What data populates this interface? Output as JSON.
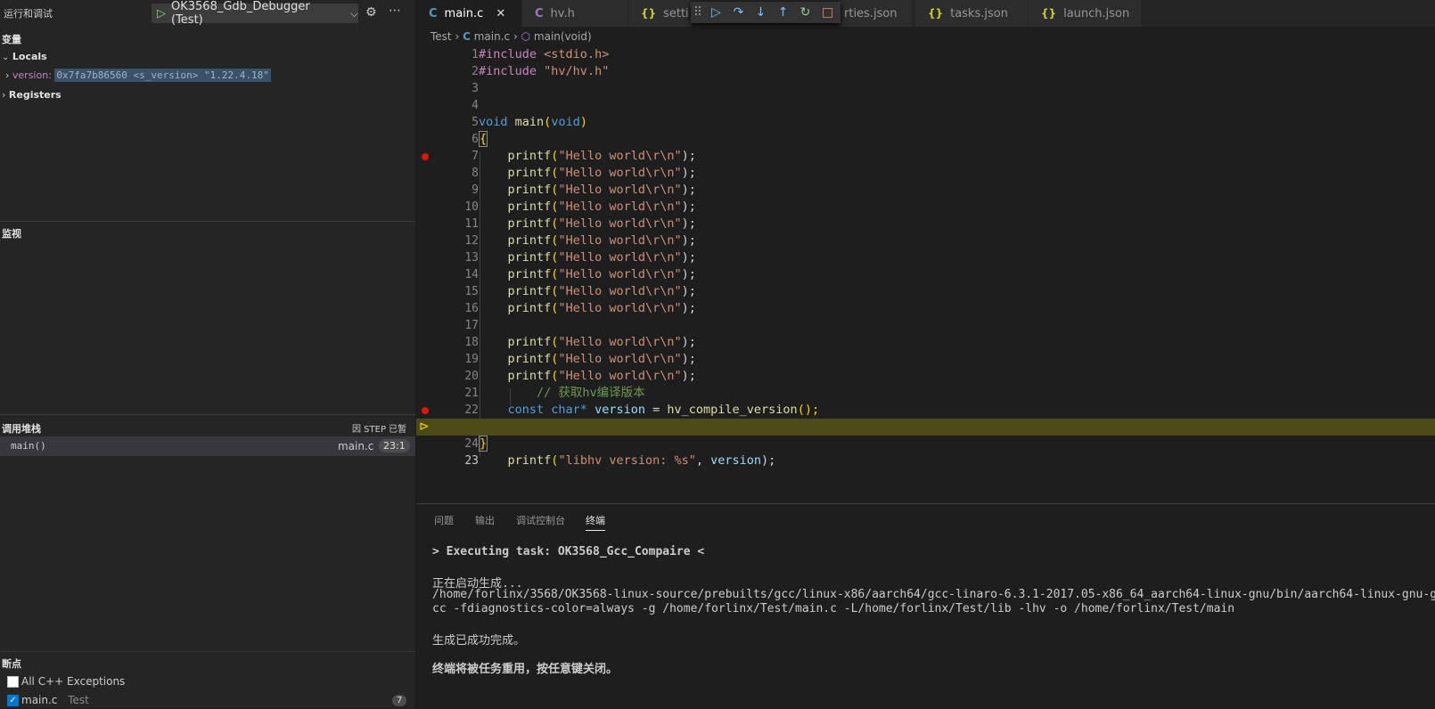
{
  "sidebar": {
    "title": "运行和调试",
    "config_name": "OK3568_Gdb_Debugger (Test)",
    "variables_title": "变量",
    "locals_label": "Locals",
    "var_name": "version:",
    "var_value": "0x7fa7b86560 <s_version> \"1.22.4.18\"",
    "registers_label": "Registers",
    "watch_title": "监视",
    "callstack_title": "调用堆栈",
    "callstack_status": "因 STEP 已暂停",
    "callstack_frame": "main()",
    "callstack_file": "main.c",
    "callstack_pos": "23:1",
    "breakpoints_title": "断点",
    "bp_exceptions": "All C++ Exceptions",
    "bp_file": "main.c",
    "bp_folder": "Test",
    "bp_count": "7"
  },
  "tabs": [
    {
      "icon": "C",
      "label": "main.c"
    },
    {
      "icon": "C",
      "label": "hv.h"
    },
    {
      "icon": "{}",
      "label": "setti"
    },
    {
      "icon": "{}",
      "label": "rties.json"
    },
    {
      "icon": "{}",
      "label": "tasks.json"
    },
    {
      "icon": "{}",
      "label": "launch.json"
    }
  ],
  "breadcrumb": {
    "folder": "Test",
    "file": "main.c",
    "symbol": "main(void)"
  },
  "code_lines": [
    "1",
    "2",
    "3",
    "4",
    "5",
    "6",
    "7",
    "8",
    "9",
    "10",
    "11",
    "12",
    "13",
    "14",
    "15",
    "16",
    "17",
    "18",
    "19",
    "20",
    "21",
    "22",
    "23",
    "24"
  ],
  "code": {
    "include1_kw": "#include",
    "include1_file": "<stdio.h>",
    "include2_kw": "#include",
    "include2_file": "\"hv/hv.h\"",
    "void_kw": "void",
    "main_fn": "main",
    "open_paren": "(",
    "param_void": "void",
    "close_paren": ")",
    "open_brace": "{",
    "printf": "printf",
    "hello_str": "\"Hello world\\r\\n\"",
    "printf_tail": ");",
    "comment": "// 获取hv编译版本",
    "const_kw": "const",
    "char_kw": "char*",
    "version_var": "version",
    "assign": " = ",
    "compile_fn": "hv_compile_version",
    "call_end": "();",
    "libhv_str": "\"libhv version: %s\"",
    "comma": ", ",
    "close_brace": "}"
  },
  "panel": {
    "tabs": [
      "问题",
      "输出",
      "调试控制台",
      "终端"
    ],
    "task_line": "> Executing task: OK3568_Gcc_Compaire <",
    "starting": "正在启动生成...",
    "cmd_line1": "/home/forlinx/3568/OK3568-linux-source/prebuilts/gcc/linux-x86/aarch64/gcc-linaro-6.3.1-2017.05-x86_64_aarch64-linux-gnu/bin/aarch64-linux-gnu-g",
    "cmd_line2": "cc -fdiagnostics-color=always -g /home/forlinx/Test/main.c -L/home/forlinx/Test/lib -lhv -o /home/forlinx/Test/main",
    "success": "生成已成功完成。",
    "reuse": "终端将被任务重用，按任意键关闭。"
  }
}
